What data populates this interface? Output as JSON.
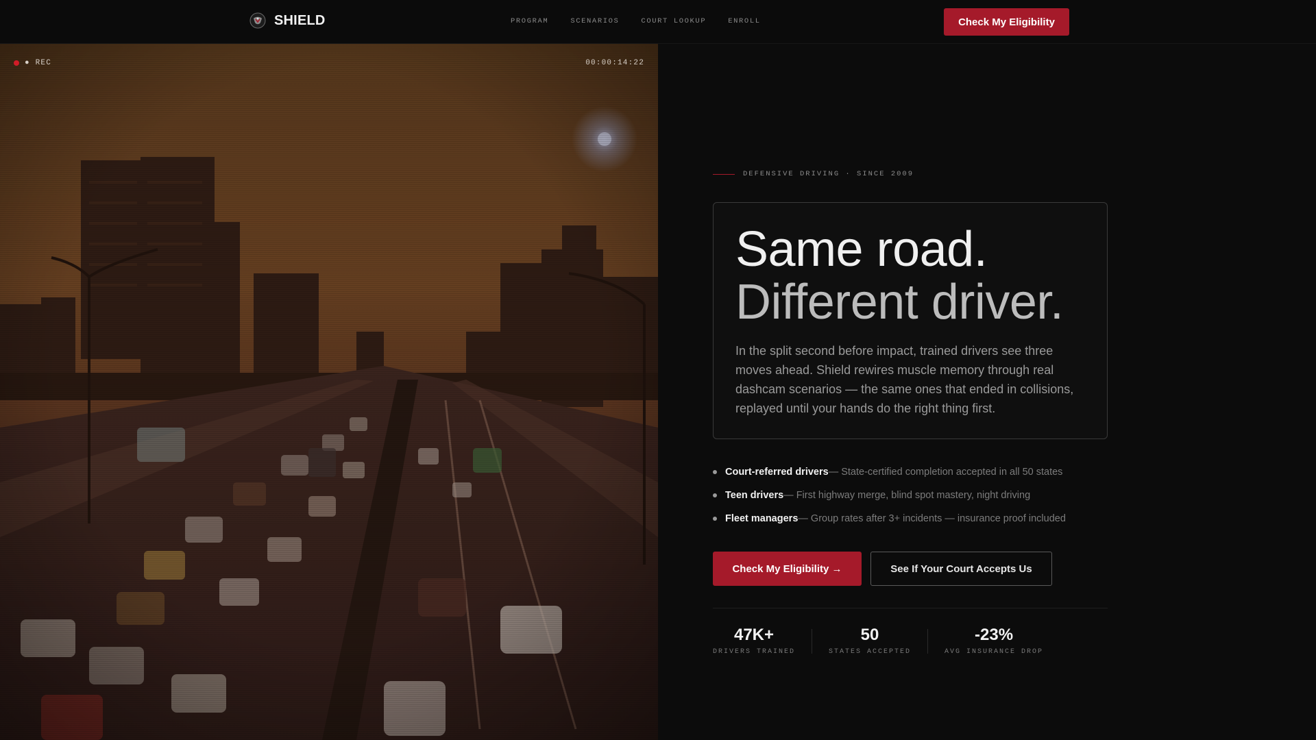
{
  "nav": {
    "brand": "SHIELD",
    "brand_icon": "shield-logo-icon",
    "links": [
      "PROGRAM",
      "SCENARIOS",
      "COURT LOOKUP",
      "ENROLL"
    ],
    "cta": "Check My Eligibility"
  },
  "video": {
    "rec_label": "● REC",
    "timecode": "00:00:14:22"
  },
  "hero": {
    "eyebrow": "DEFENSIVE DRIVING · SINCE 2009",
    "headline_line1": "Same road.",
    "headline_line2": "Different driver.",
    "body": "In the split second before impact, trained drivers see three moves ahead. Shield rewires muscle memory through real dashcam scenarios — the same ones that ended in collisions, replayed until your hands do the right thing first."
  },
  "audiences": [
    {
      "title": "Court-referred drivers",
      "desc": " — State-certified completion accepted in all 50 states"
    },
    {
      "title": "Teen drivers",
      "desc": " — First highway merge, blind spot mastery, night driving"
    },
    {
      "title": "Fleet managers",
      "desc": " — Group rates after 3+ incidents — insurance proof included"
    }
  ],
  "cta": {
    "primary": "Check My Eligibility →",
    "secondary": "See If Your Court Accepts Us"
  },
  "stats": [
    {
      "value": "47K+",
      "label": "DRIVERS TRAINED"
    },
    {
      "value": "50",
      "label": "STATES ACCEPTED"
    },
    {
      "value": "-23%",
      "label": "AVG INSURANCE DROP"
    }
  ],
  "colors": {
    "accent": "#a51a2a",
    "background": "#0c0c0c",
    "rec_dot": "#d11c28"
  }
}
